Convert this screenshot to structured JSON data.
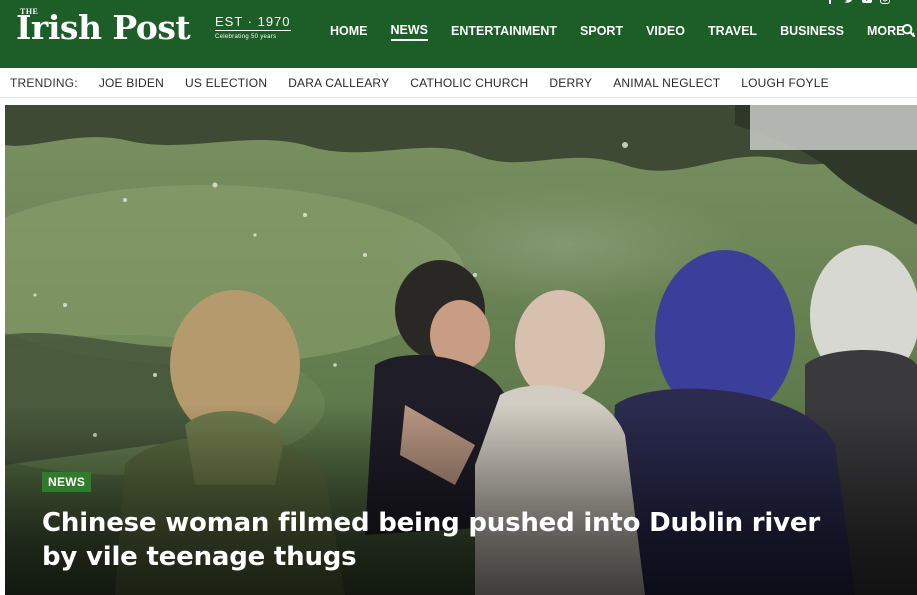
{
  "header": {
    "logo_the": "THE",
    "logo": "Irish Post",
    "est": "EST · 1970",
    "celebrating": "Celebrating 50 years",
    "nav": [
      {
        "label": "HOME"
      },
      {
        "label": "NEWS",
        "active": true
      },
      {
        "label": "ENTERTAINMENT"
      },
      {
        "label": "SPORT"
      },
      {
        "label": "VIDEO"
      },
      {
        "label": "TRAVEL"
      },
      {
        "label": "BUSINESS"
      },
      {
        "label": "MORE"
      }
    ],
    "more_chevron": "⌄",
    "brand_color": "#1d5d27"
  },
  "trending": {
    "label": "TRENDING:",
    "items": [
      "JOE BIDEN",
      "US ELECTION",
      "DARA CALLEARY",
      "CATHOLIC CHURCH",
      "DERRY",
      "ANIMAL NEGLECT",
      "LOUGH FOYLE"
    ]
  },
  "hero": {
    "category": "NEWS",
    "headline": "Chinese woman filmed being pushed into Dublin river by vile teenage thugs",
    "badge_color": "#2f7d2c"
  }
}
